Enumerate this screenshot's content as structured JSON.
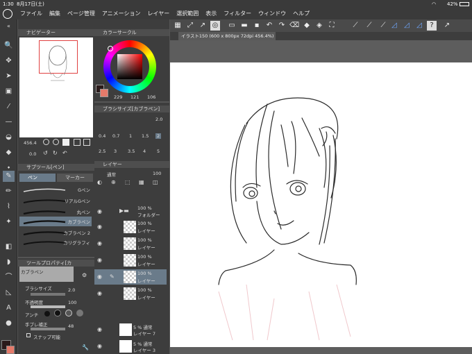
{
  "status": {
    "time": "1:30",
    "date": "8月17日(土)",
    "battery": "42%"
  },
  "menu": [
    "ファイル",
    "編集",
    "ページ管理",
    "アニメーション",
    "レイヤー",
    "選択範囲",
    "表示",
    "フィルター",
    "ウィンドウ",
    "ヘルプ"
  ],
  "navigator": {
    "title": "ナビゲーター",
    "zoom": "456.4",
    "angle": "0.0"
  },
  "colorcircle": {
    "title": "カラーサークル",
    "r": "229",
    "g": "121",
    "b": "106"
  },
  "brushsize": {
    "title": "ブラシサイズ[カブラペン]",
    "current": "2.0",
    "sizes_row1": [
      "0.4",
      "0.7",
      "1",
      "1.5",
      "2"
    ],
    "sizes_row2": [
      "2.5",
      "3",
      "3.5",
      "4",
      "5"
    ]
  },
  "subtool": {
    "title": "サブツール[ペン]",
    "tab_pen": "ペン",
    "tab_marker": "マーカー",
    "items": [
      "Gペン",
      "リアルGペン",
      "丸ペン",
      "カブラペン",
      "カブラペン 2",
      "カリグラフィ"
    ]
  },
  "toolprop": {
    "title": "ツールプロパティ[カ",
    "current_tool": "カブラペン",
    "size_label": "ブラシサイズ",
    "size_val": "2.0",
    "opacity_label": "不透明度",
    "opacity_val": "100",
    "aa_label": "アンチ",
    "stab_label": "手ブレ補正",
    "stab_val": "48",
    "snap_label": "スナップ可能"
  },
  "layer": {
    "title": "レイヤー",
    "blend": "通常",
    "opacity": "100",
    "items": [
      {
        "pct": "100 %",
        "name": "フォルダー"
      },
      {
        "pct": "100 %",
        "name": "レイヤー"
      },
      {
        "pct": "100 %",
        "name": "レイヤー"
      },
      {
        "pct": "100 %",
        "name": "レイヤー"
      },
      {
        "pct": "100 %",
        "name": "レイヤー"
      },
      {
        "pct": "100 %",
        "name": "レイヤー"
      },
      {
        "pct": "5 % 通常",
        "name": "レイヤー 7"
      },
      {
        "pct": "5 % 通常",
        "name": "レイヤー 3"
      }
    ]
  },
  "document": {
    "tab": "イラスト150 (600 x 800px 72dpi 456.4%)"
  },
  "colors": {
    "accent": "#6a7b8a",
    "fg": "#2a1a1a",
    "bg": "#e57a6a"
  }
}
